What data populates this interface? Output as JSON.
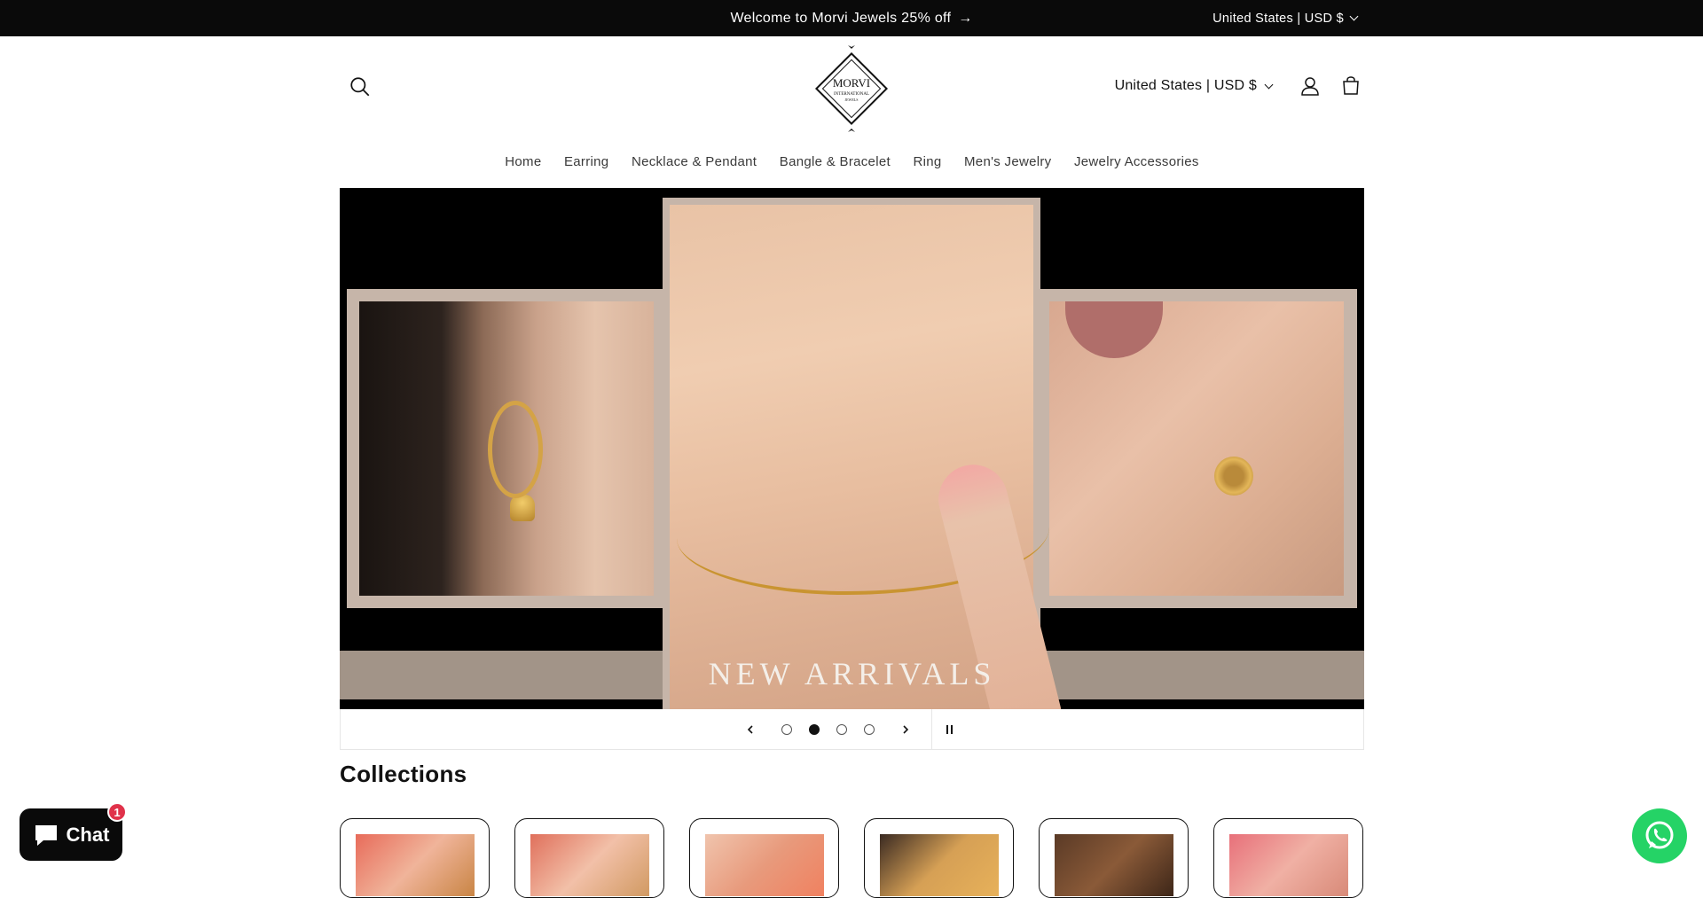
{
  "announcement": {
    "message": "Welcome to Morvi Jewels 25% off",
    "country_selector": "United States | USD $"
  },
  "header": {
    "logo_text": "MORVI",
    "logo_subtext": "INTERNATIONAL",
    "logo_small": "JEWELS",
    "country_selector": "United States | USD $"
  },
  "nav": {
    "items": [
      "Home",
      "Earring",
      "Necklace & Pendant",
      "Bangle & Bracelet",
      "Ring",
      "Men's Jewelry",
      "Jewelry Accessories"
    ]
  },
  "slideshow": {
    "title": "NEW ARRIVALS",
    "slide_count": 4,
    "active_slide": 2
  },
  "collections": {
    "title": "Collections"
  },
  "chat": {
    "label": "Chat",
    "badge": "1"
  },
  "colors": {
    "announcement_bg": "#0a0a0a",
    "accent": "#121212",
    "whatsapp": "#25d366",
    "badge": "#e0324a"
  }
}
